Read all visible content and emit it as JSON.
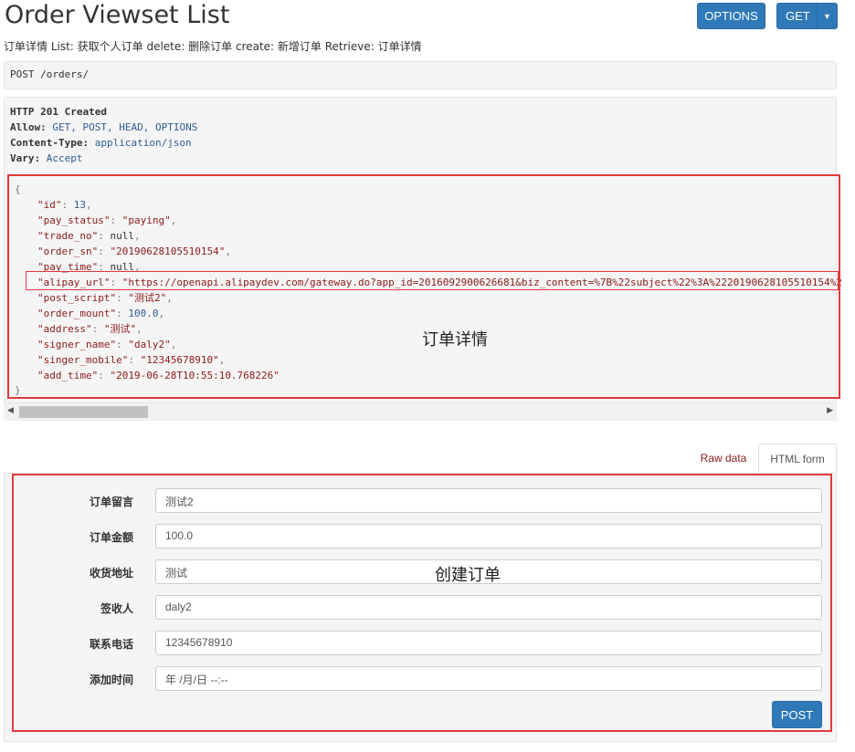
{
  "header": {
    "title": "Order Viewset List",
    "description": "订单详情 List: 获取个人订单 delete: 删除订单 create: 新增订单 Retrieve: 订单详情",
    "options_button": "OPTIONS",
    "get_button": "GET",
    "get_caret_icon": "caret-down-icon"
  },
  "request": {
    "line": "POST /orders/"
  },
  "response": {
    "status_line": "HTTP 201 Created",
    "headers": [
      {
        "name": "Allow:",
        "value": "GET, POST, HEAD, OPTIONS"
      },
      {
        "name": "Content-Type:",
        "value": "application/json"
      },
      {
        "name": "Vary:",
        "value": "Accept"
      }
    ],
    "json": {
      "open": "{",
      "close": "}",
      "fields": [
        {
          "key": "\"id\"",
          "value": "13",
          "type": "number",
          "comma": ","
        },
        {
          "key": "\"pay_status\"",
          "value": "\"paying\"",
          "type": "string",
          "comma": ","
        },
        {
          "key": "\"trade_no\"",
          "value": "null",
          "type": "null",
          "comma": ","
        },
        {
          "key": "\"order_sn\"",
          "value": "\"20190628105510154\"",
          "type": "string",
          "comma": ","
        },
        {
          "key": "\"pay_time\"",
          "value": "null",
          "type": "null",
          "comma": ","
        },
        {
          "key": "\"alipay_url\"",
          "value": "\"https://openapi.alipaydev.com/gateway.do?app_id=2016092900626681&biz_content=%7B%22subject%22%3A%2220190628105510154%2",
          "type": "string",
          "comma": ""
        },
        {
          "key": "\"post_script\"",
          "value": "\"测试2\"",
          "type": "string",
          "comma": ","
        },
        {
          "key": "\"order_mount\"",
          "value": "100.0",
          "type": "number",
          "comma": ","
        },
        {
          "key": "\"address\"",
          "value": "\"测试\"",
          "type": "string",
          "comma": ","
        },
        {
          "key": "\"signer_name\"",
          "value": "\"daly2\"",
          "type": "string",
          "comma": ","
        },
        {
          "key": "\"singer_mobile\"",
          "value": "\"12345678910\"",
          "type": "string",
          "comma": ","
        },
        {
          "key": "\"add_time\"",
          "value": "\"2019-06-28T10:55:10.768226\"",
          "type": "string",
          "comma": ""
        }
      ]
    },
    "annotation": "订单详情",
    "scroll_left_icon": "◀",
    "scroll_right_icon": "▶"
  },
  "tabs": [
    {
      "label": "Raw data"
    },
    {
      "label": "HTML form"
    }
  ],
  "form": {
    "annotation": "创建订单",
    "fields": [
      {
        "label": "订单留言",
        "value": "测试2"
      },
      {
        "label": "订单金额",
        "value": "100.0"
      },
      {
        "label": "收货地址",
        "value": "测试"
      },
      {
        "label": "签收人",
        "value": "daly2"
      },
      {
        "label": "联系电话",
        "value": "12345678910"
      },
      {
        "label": "添加时间",
        "value": "年 /月/日 --:--"
      }
    ],
    "submit_label": "POST"
  },
  "colors": {
    "primary_button": "#2f79b8",
    "annotation_border": "#e03a3a",
    "json_string": "#8b1a1a",
    "json_number": "#2f5d91"
  }
}
